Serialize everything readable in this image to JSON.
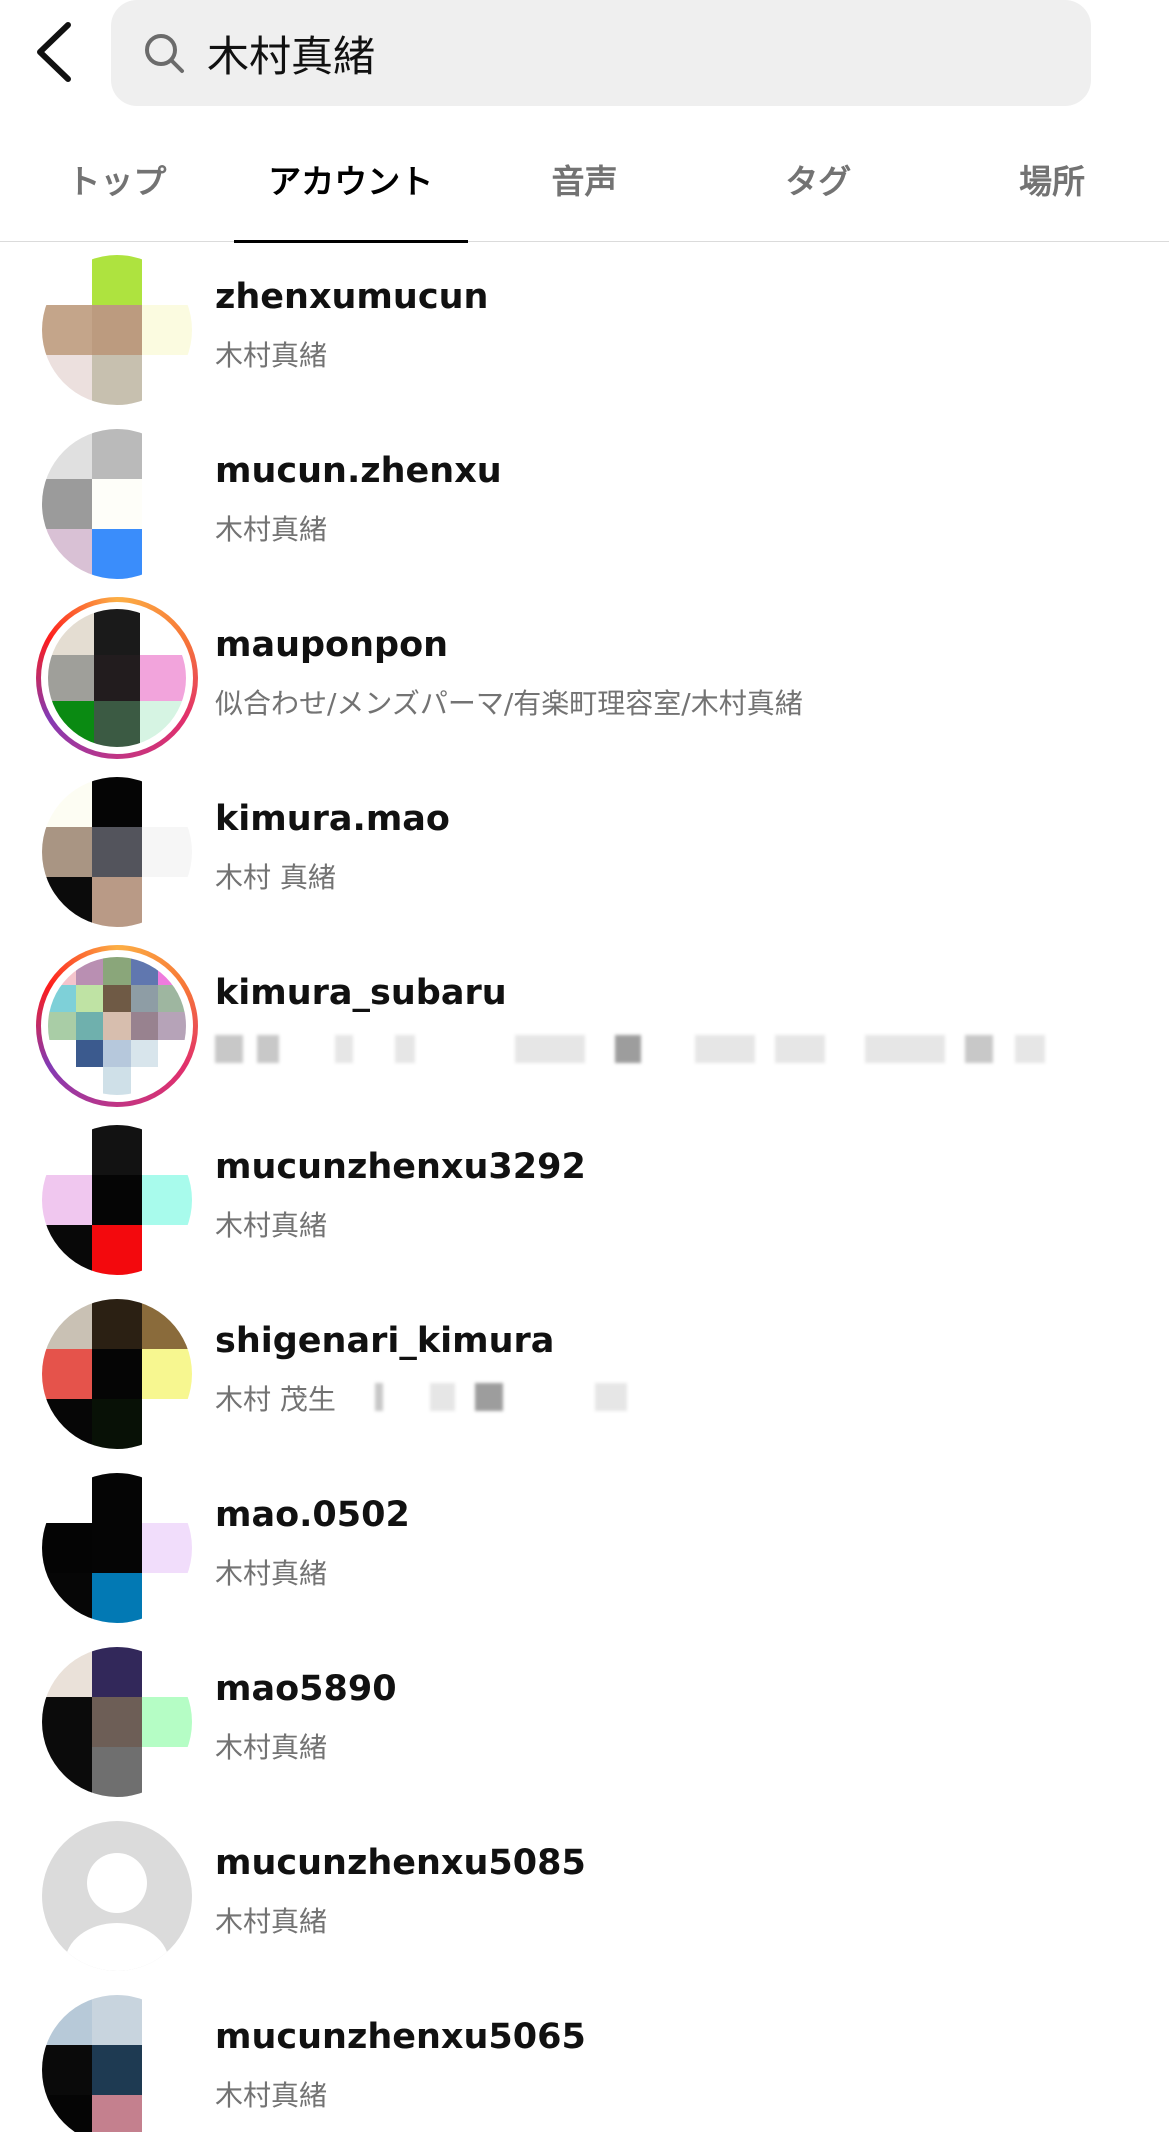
{
  "search": {
    "query": "木村真緒"
  },
  "tabs": [
    {
      "label": "トップ",
      "active": false
    },
    {
      "label": "アカウント",
      "active": true
    },
    {
      "label": "音声",
      "active": false
    },
    {
      "label": "タグ",
      "active": false
    },
    {
      "label": "場所",
      "active": false
    }
  ],
  "results": [
    {
      "username": "zhenxumucun",
      "fullname": "木村真緒",
      "avatar": {
        "grid": 3,
        "ring": false,
        "colors": [
          "#ffffff",
          "#aee33f",
          "#ffffff",
          "#c4a58a",
          "#bc9b7f",
          "#fbfbe0",
          "#ece0de",
          "#c7c0af",
          "#ffffff"
        ]
      }
    },
    {
      "username": "mucun.zhenxu",
      "fullname": "木村真緒",
      "avatar": {
        "grid": 3,
        "ring": false,
        "colors": [
          "#e0e0e0",
          "#bababa",
          "#ffffff",
          "#9b9b9b",
          "#fefef9",
          "#ffffff",
          "#d9c1d5",
          "#3a8dfb",
          "#ffffff"
        ]
      }
    },
    {
      "username": "mauponpon",
      "fullname": "似合わせ/メンズパーマ/有楽町理容室/木村真緒",
      "avatar": {
        "grid": 3,
        "ring": true,
        "colors": [
          "#e4ddd2",
          "#1a1a1a",
          "#ffffff",
          "#9f9f9a",
          "#221c1e",
          "#f2a4dc",
          "#0a8a12",
          "#3b5a43",
          "#d6f4e3"
        ]
      }
    },
    {
      "username": "kimura.mao",
      "fullname": "木村 真緒",
      "avatar": {
        "grid": 3,
        "ring": false,
        "colors": [
          "#fdfdf3",
          "#050505",
          "#ffffff",
          "#a99583",
          "#53545c",
          "#f6f6f6",
          "#0b0b0b",
          "#b99a86",
          "#ffffff"
        ]
      }
    },
    {
      "username": "kimura_subaru",
      "fullname": "",
      "blurred": true,
      "avatar": {
        "grid": 5,
        "ring": true,
        "colors": [
          "#f4c4cc",
          "#b98fb2",
          "#8aa67a",
          "#6077af",
          "#ee7bdd",
          "#7ed0d8",
          "#bfe3a4",
          "#6f5a45",
          "#8e9da5",
          "#9eb6a0",
          "#a9cda6",
          "#6fb0ad",
          "#d7beae",
          "#98828f",
          "#b6a3b8",
          "#ffffff",
          "#3b5a8e",
          "#b6c8dc",
          "#d8e5ec",
          "#ffffff",
          "#ffffff",
          "#ffffff",
          "#cfe0e8",
          "#ffffff",
          "#ffffff"
        ]
      }
    },
    {
      "username": "mucunzhenxu3292",
      "fullname": "木村真緒",
      "avatar": {
        "grid": 3,
        "ring": false,
        "colors": [
          "#ffffff",
          "#121212",
          "#ffffff",
          "#f0c7ef",
          "#050505",
          "#a8fbec",
          "#080808",
          "#f3090d",
          "#ffffff"
        ]
      }
    },
    {
      "username": "shigenari_kimura",
      "fullname": "木村 茂生",
      "blurredTail": true,
      "avatar": {
        "grid": 3,
        "ring": false,
        "colors": [
          "#c9c1b4",
          "#2b2013",
          "#8a6b3b",
          "#e5534b",
          "#050505",
          "#f7f790",
          "#060606",
          "#081106",
          "#ffffff"
        ]
      }
    },
    {
      "username": "mao.0502",
      "fullname": "木村真緒",
      "avatar": {
        "grid": 3,
        "ring": false,
        "colors": [
          "#ffffff",
          "#050505",
          "#ffffff",
          "#040404",
          "#050505",
          "#f1ddfb",
          "#060606",
          "#0279b4",
          "#ffffff"
        ]
      }
    },
    {
      "username": "mao5890",
      "fullname": "木村真緒",
      "avatar": {
        "grid": 3,
        "ring": false,
        "colors": [
          "#eae1d9",
          "#32285a",
          "#ffffff",
          "#0b0b0b",
          "#6d5e56",
          "#b5fdc5",
          "#0b0b0b",
          "#6f6f6f",
          "#ffffff"
        ]
      }
    },
    {
      "username": "mucunzhenxu5085",
      "fullname": "木村真緒",
      "avatar": {
        "grid": 0,
        "ring": false,
        "colors": []
      }
    },
    {
      "username": "mucunzhenxu5065",
      "fullname": "木村真緒",
      "avatar": {
        "grid": 3,
        "ring": false,
        "colors": [
          "#b7c9d8",
          "#c8d4de",
          "#ffffff",
          "#0a0a0a",
          "#1e3a52",
          "#ffffff",
          "#050505",
          "#c4808e",
          "#ffffff"
        ]
      }
    }
  ]
}
